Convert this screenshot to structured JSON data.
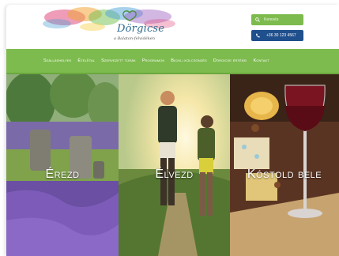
{
  "header": {
    "logo_text": "Dörgicse",
    "logo_subtitle": "a Balaton-felvidéken",
    "search_placeholder": "Keresés",
    "phone": "+36 30 123 4567"
  },
  "colors": {
    "nav_green": "#7dbb4e",
    "phone_blue": "#1f4f8c",
    "logo_blue": "#2e6a8e"
  },
  "nav": {
    "items": [
      "Szálláshelyek",
      "Étel/ital",
      "Szervezett túrák",
      "Programok",
      "Bicikli kölcsönzés",
      "Dörgicse értékei",
      "Kontakt"
    ]
  },
  "panels": [
    {
      "label": "Érezd",
      "icon": "lavender-field-image"
    },
    {
      "label": "Élvezd",
      "icon": "hikers-image"
    },
    {
      "label": "Kóstold bele",
      "icon": "wine-cheese-image"
    }
  ]
}
